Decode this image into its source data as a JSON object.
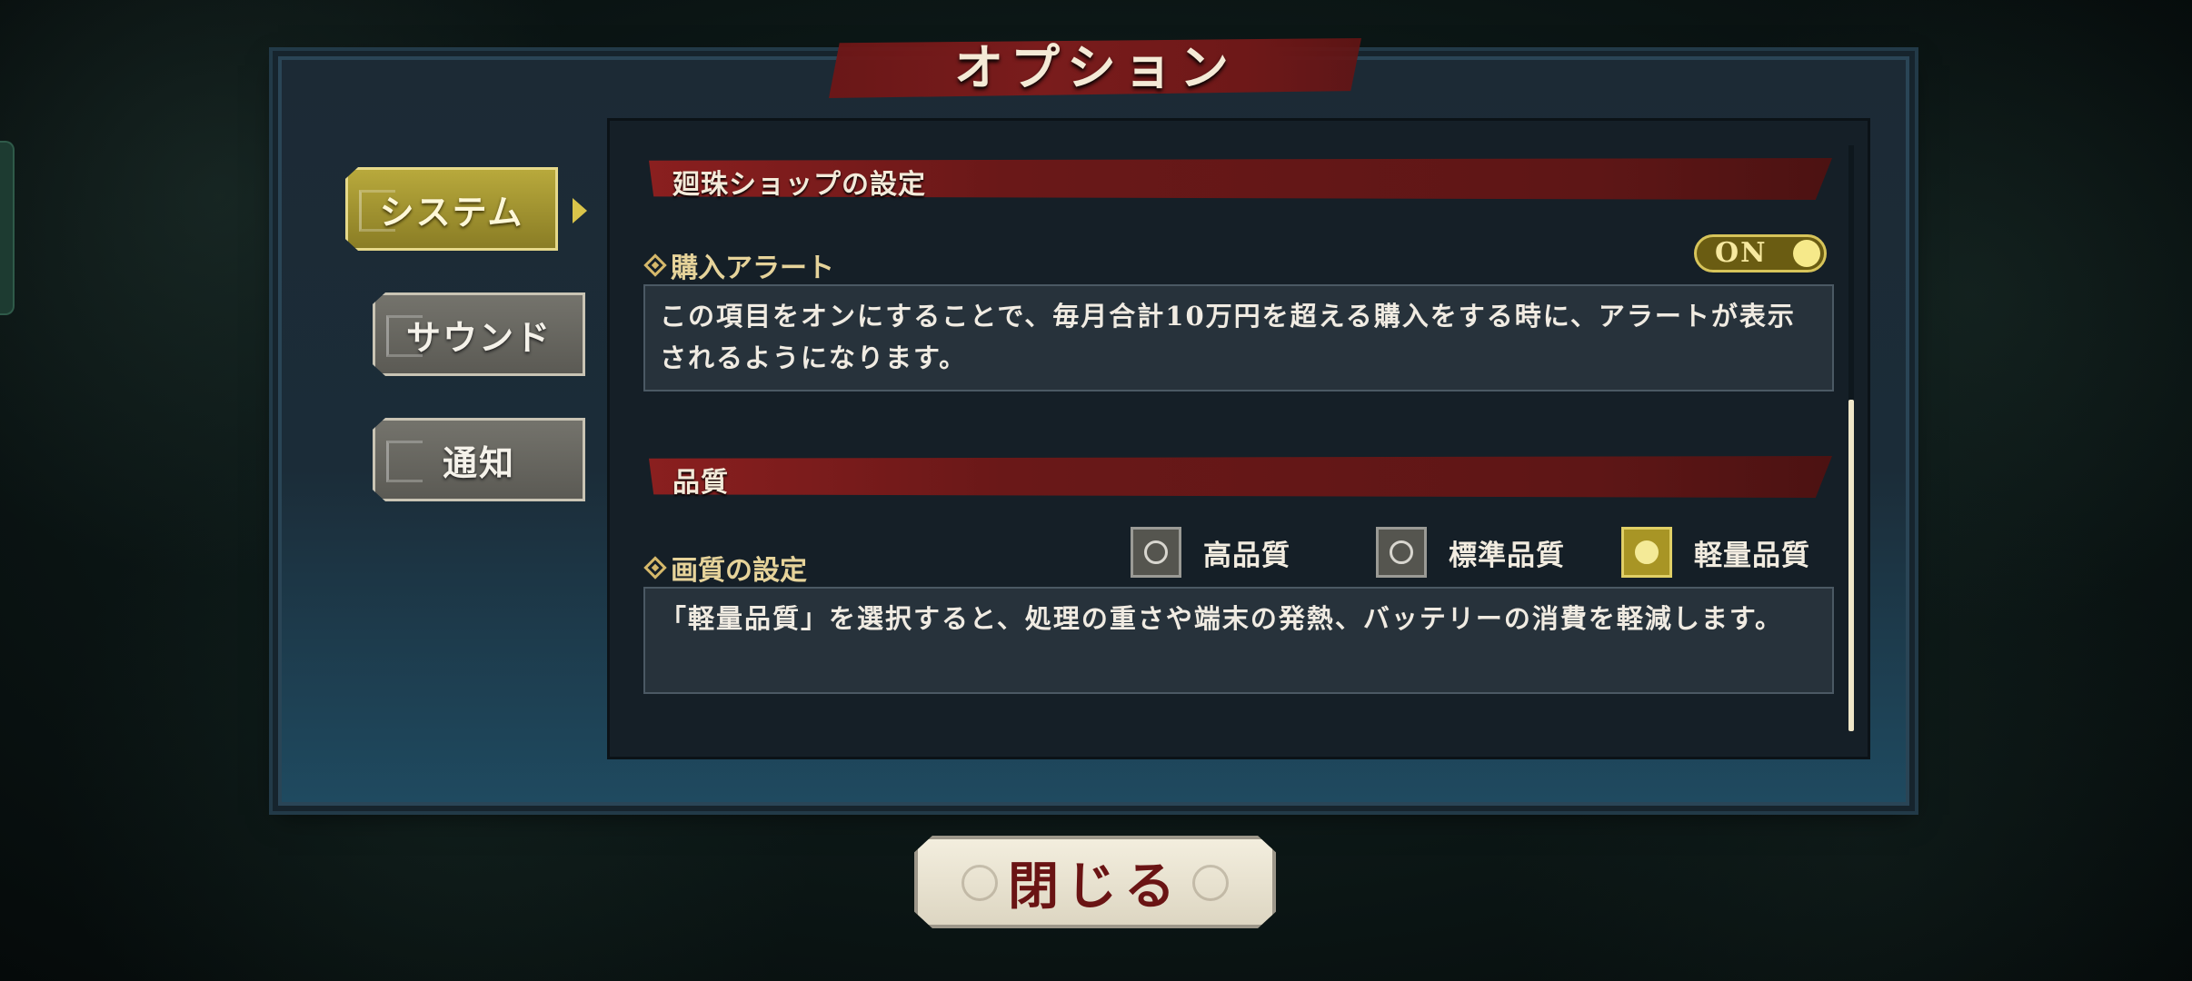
{
  "dialog": {
    "title": "オプション"
  },
  "tabs": [
    {
      "label": "システム",
      "active": true
    },
    {
      "label": "サウンド",
      "active": false
    },
    {
      "label": "通知",
      "active": false
    }
  ],
  "sections": {
    "shop": {
      "title": "廻珠ショップの設定",
      "purchase_alert": {
        "label": "購入アラート",
        "toggle_text": "ON",
        "enabled": true,
        "description": "この項目をオンにすることで、毎月合計10万円を超える購入をする時に、アラートが表示されるようになります。"
      }
    },
    "quality": {
      "title": "品質",
      "image_quality": {
        "label": "画質の設定",
        "options": [
          "高品質",
          "標準品質",
          "軽量品質"
        ],
        "selected": "軽量品質",
        "description": "「軽量品質」を選択すると、処理の重さや端末の発熱、バッテリーの消費を軽減します。"
      }
    }
  },
  "close_button": {
    "label": "閉じる"
  },
  "colors": {
    "accent_gold": "#b8a93c",
    "banner_red": "#7a1c1c",
    "panel_bg": "#151f27"
  }
}
